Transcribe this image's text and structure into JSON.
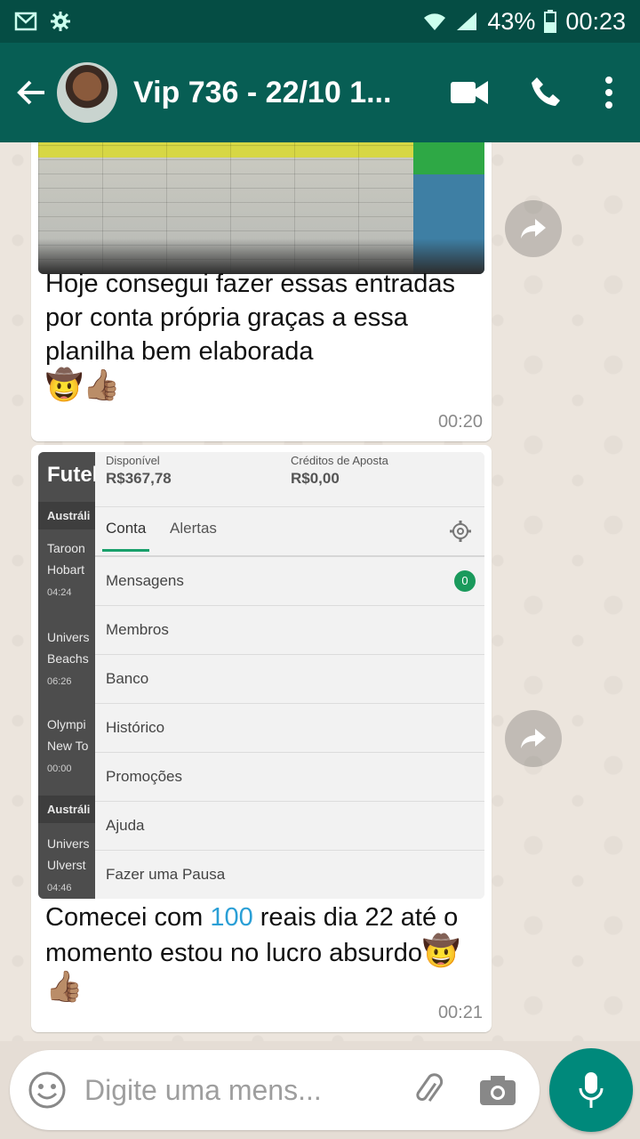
{
  "status": {
    "battery": "43%",
    "time": "00:23"
  },
  "header": {
    "title": "Vip 736 - 22/10 1..."
  },
  "messages": [
    {
      "text": "Hoje consegui fazer essas entradas por conta própria graças a essa planilha bem elaborada",
      "emoji": "🤠👍🏽",
      "time": "00:20"
    },
    {
      "text_before": "Comecei com ",
      "number": "100",
      "text_after": " reais dia 22 até  o momento estou no lucro absurdo",
      "emoji": "🤠👍🏽",
      "time": "00:21"
    }
  ],
  "screenshot2": {
    "brand": "Futel",
    "categories": [
      "Austráli",
      "Austráli"
    ],
    "matches": [
      {
        "line1": "Taroon",
        "line2": "Hobart",
        "time": "04:24"
      },
      {
        "line1": "Univers",
        "line2": "Beachs",
        "time": "06:26"
      },
      {
        "line1": "Olympi",
        "line2": "New To",
        "time": "00:00"
      },
      {
        "line1": "Univers",
        "line2": "Ulverst",
        "time": "04:46"
      }
    ],
    "balance": {
      "available_label": "Disponível",
      "available_value": "R$367,78",
      "credits_label": "Créditos de Aposta",
      "credits_value": "R$0,00"
    },
    "tabs": [
      "Conta",
      "Alertas"
    ],
    "menu": [
      "Mensagens",
      "Membros",
      "Banco",
      "Histórico",
      "Promoções",
      "Ajuda",
      "Fazer uma Pausa"
    ],
    "messages_badge": "0"
  },
  "input": {
    "placeholder": "Digite uma mens..."
  },
  "colors": {
    "header": "#075e54",
    "statusbar": "#054d44",
    "accent": "#00897b"
  }
}
